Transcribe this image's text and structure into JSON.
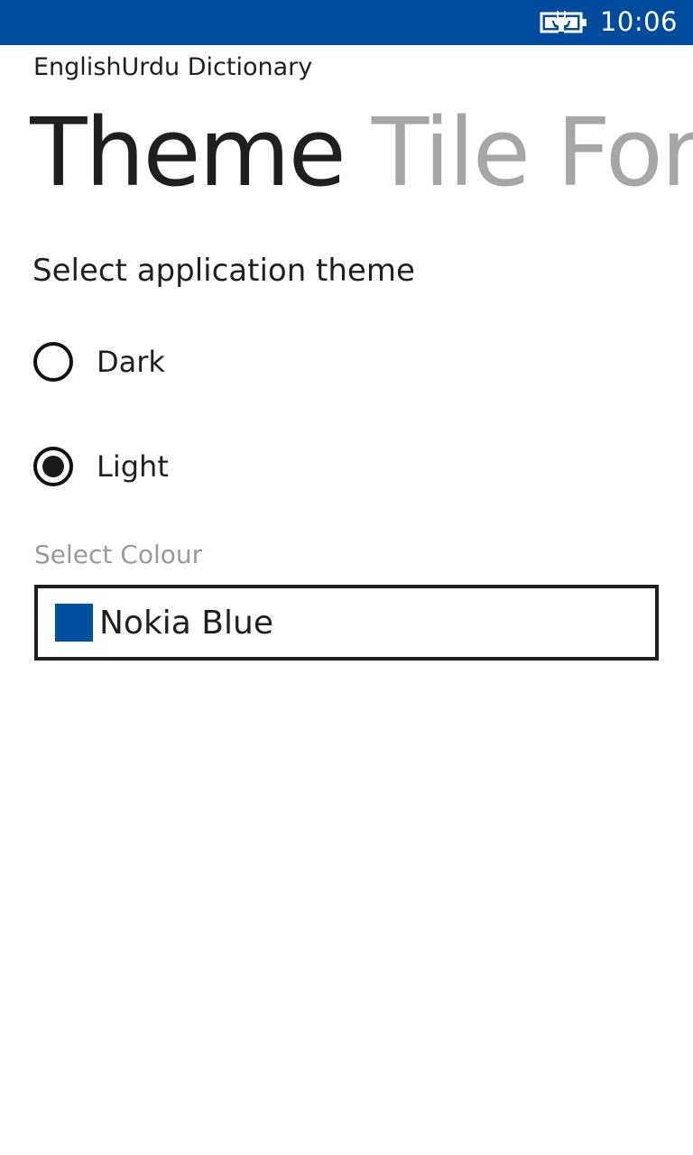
{
  "status_bar": {
    "clock": "10:06",
    "battery_icon": "battery-charging-icon",
    "background_color": "#004b9c"
  },
  "app": {
    "title": "EnglishUrdu Dictionary"
  },
  "pivot": {
    "items": [
      {
        "label": "Theme",
        "active": true
      },
      {
        "label": "Tile Font",
        "active": false
      }
    ]
  },
  "theme_section": {
    "heading": "Select application theme",
    "options": [
      {
        "label": "Dark",
        "selected": false
      },
      {
        "label": "Light",
        "selected": true
      }
    ]
  },
  "colour_section": {
    "label": "Select Colour",
    "selected_name": "Nokia Blue",
    "selected_color": "#0050a0"
  }
}
